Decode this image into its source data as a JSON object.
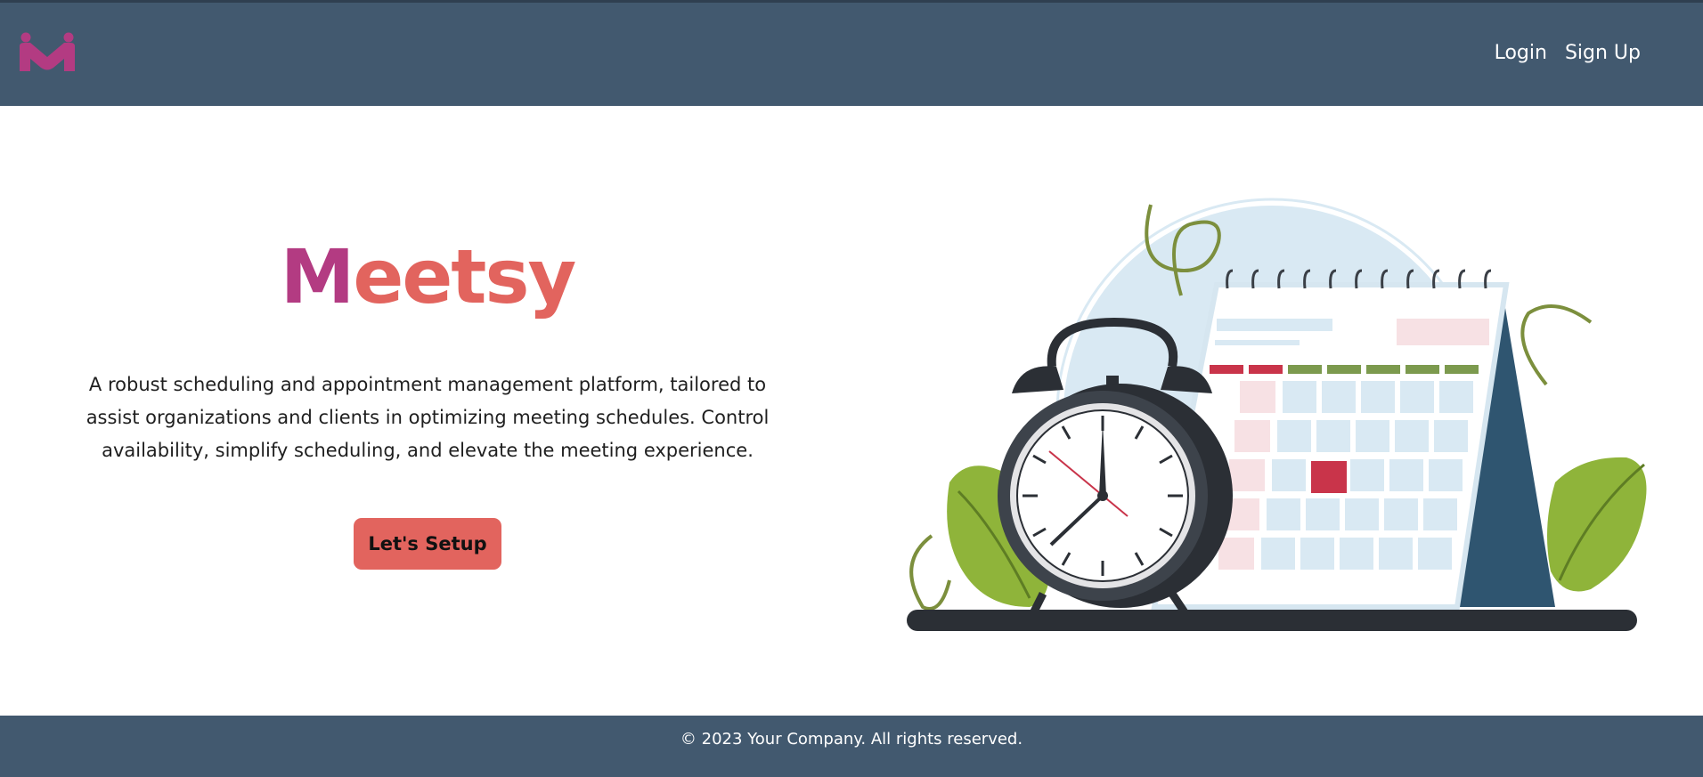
{
  "header": {
    "logo_icon": "meetsy-logo-icon",
    "nav": {
      "login_label": "Login",
      "signup_label": "Sign Up"
    }
  },
  "hero": {
    "title_first": "M",
    "title_rest": "eetsy",
    "description": "A robust scheduling and appointment management platform, tailored to assist organizations and clients in optimizing meeting schedules. Control availability, simplify scheduling, and elevate the meeting experience.",
    "cta_label": "Let's Setup",
    "illustration_icon": "calendar-clock-illustration-icon"
  },
  "footer": {
    "copyright": "© 2023 Your Company. All rights reserved."
  },
  "colors": {
    "header_bg": "#42596f",
    "brand_magenta": "#b33b82",
    "brand_coral": "#e2645e",
    "footer_bg": "#42596f"
  }
}
